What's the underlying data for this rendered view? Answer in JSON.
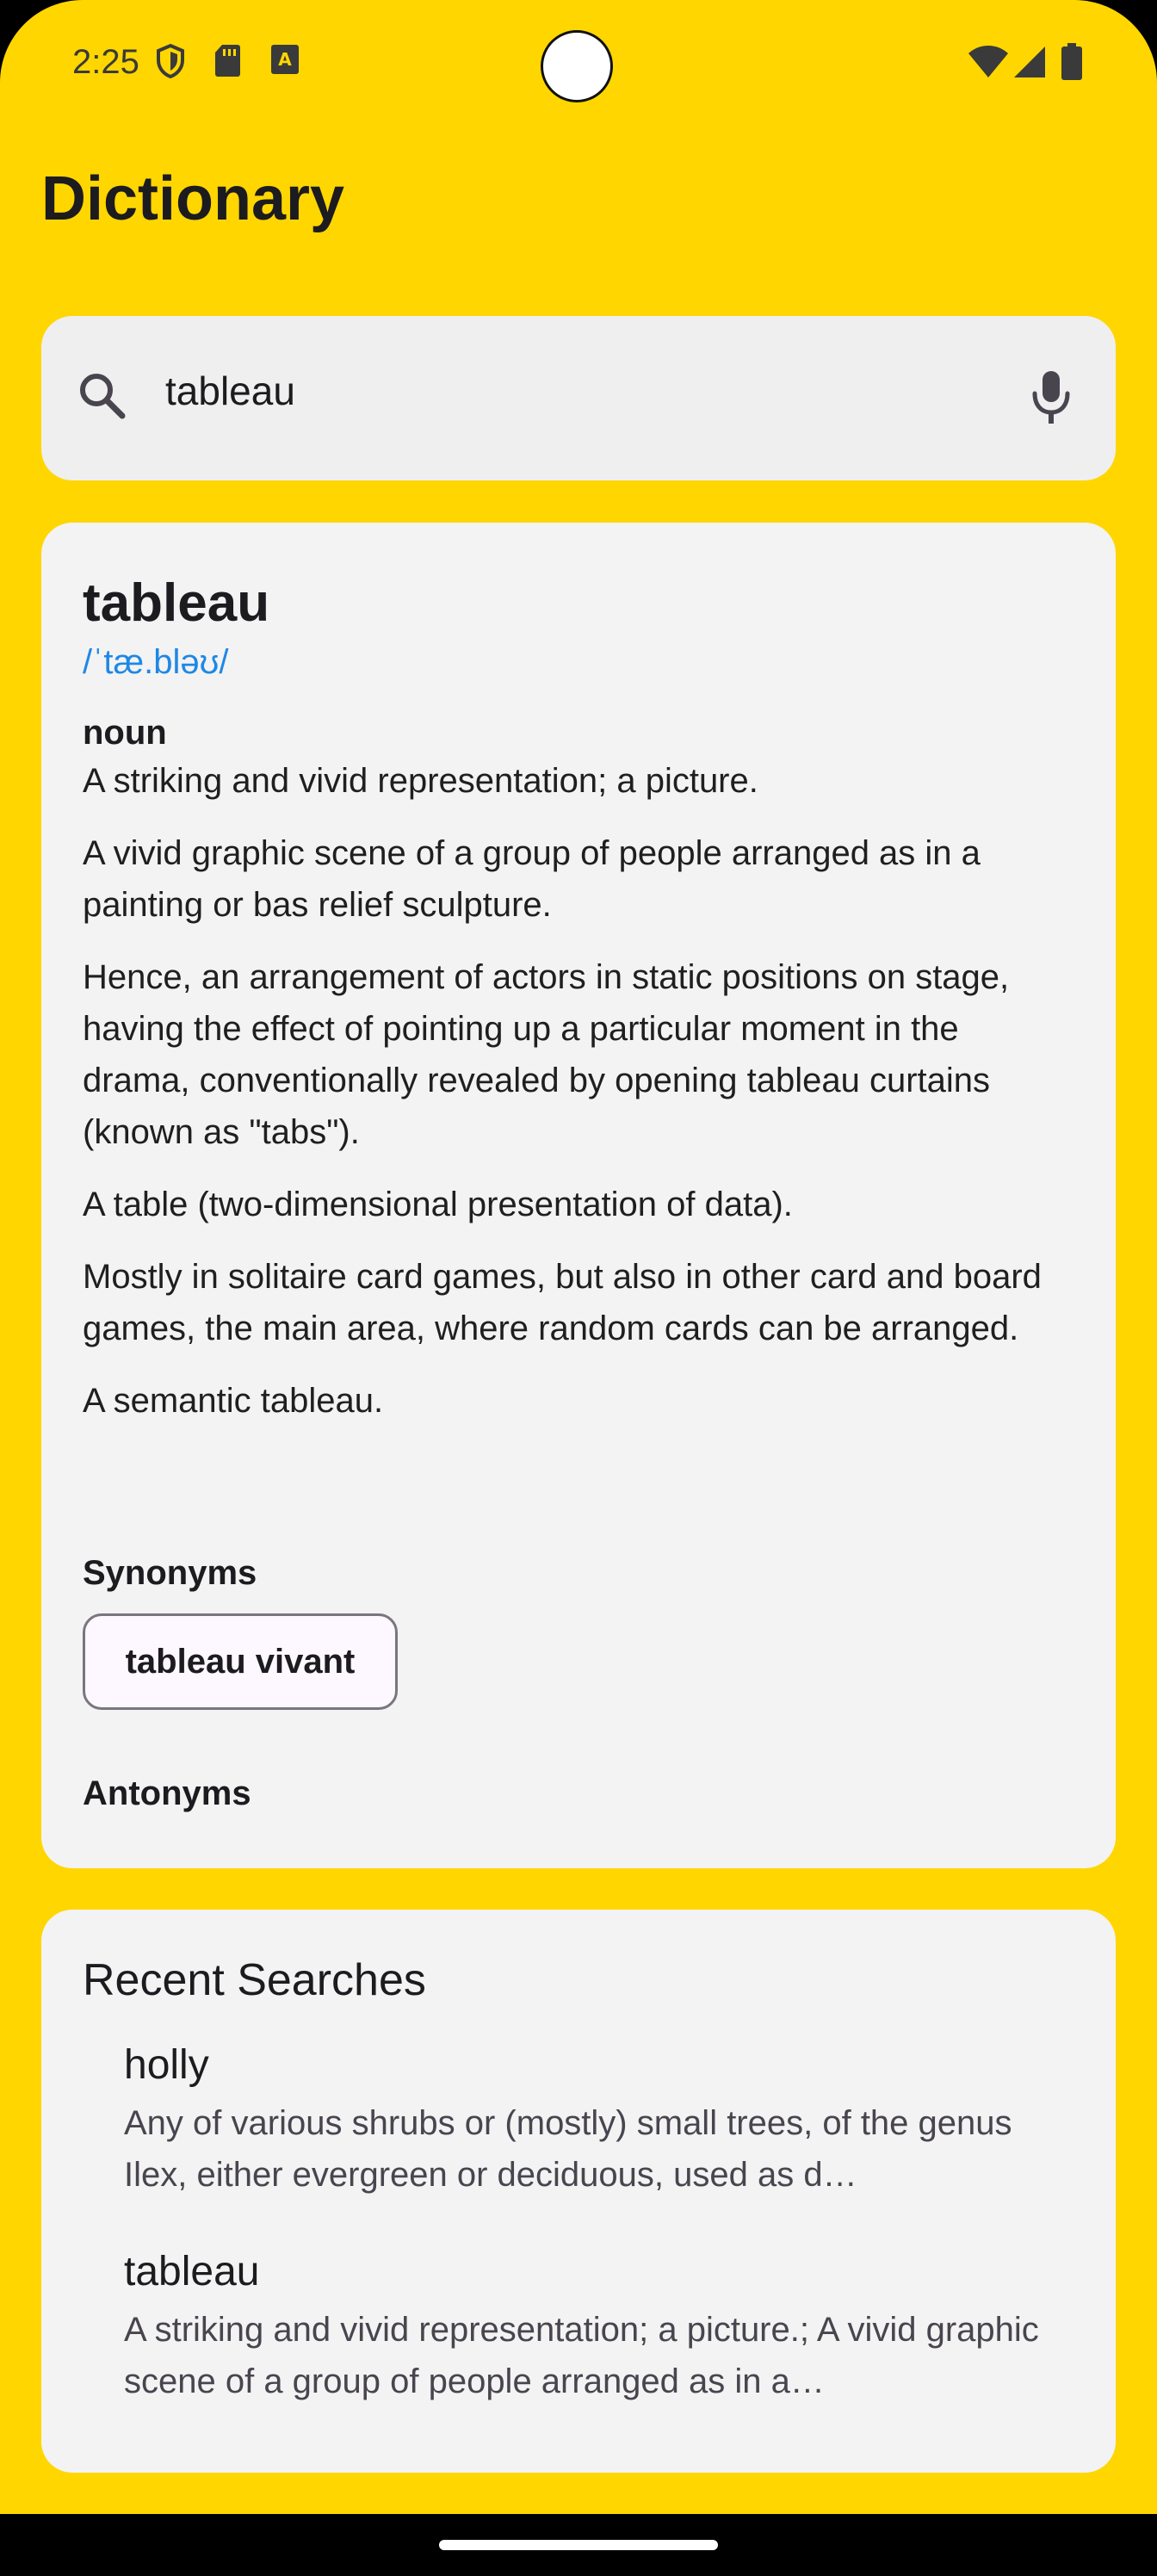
{
  "status_bar": {
    "time": "2:25",
    "left_icons": [
      "shield-icon",
      "sd-card-icon",
      "font-notification-icon"
    ],
    "right_icons": [
      "wifi-icon",
      "cellular-signal-icon",
      "battery-icon"
    ]
  },
  "app": {
    "title": "Dictionary",
    "accent_color": "#FFD600"
  },
  "search": {
    "value": "tableau",
    "leading_icon": "search-icon",
    "trailing_icon": "mic-icon"
  },
  "entry": {
    "word": "tableau",
    "phonetic": "/ˈtæ.bləʊ/",
    "part_of_speech": "noun",
    "definitions": [
      "A striking and vivid representation; a picture.",
      "A vivid graphic scene of a group of people arranged as in a painting or bas relief sculpture.",
      "Hence, an arrangement of actors in static positions on stage, having the effect of pointing up a particular moment in the drama, conventionally revealed by opening tableau curtains (known as \"tabs\").",
      "A table (two-dimensional presentation of data).",
      "Mostly in solitaire card games, but also in other card and board games, the main area, where random cards can be arranged.",
      "A semantic tableau."
    ],
    "synonyms_label": "Synonyms",
    "synonyms": [
      "tableau vivant"
    ],
    "antonyms_label": "Antonyms"
  },
  "recent": {
    "title": "Recent Searches",
    "items": [
      {
        "word": "holly",
        "snippet": "Any of various shrubs or (mostly) small trees, of the genus Ilex, either evergreen or deciduous, used as d…"
      },
      {
        "word": "tableau",
        "snippet": "A striking and vivid representation; a picture.; A vivid graphic scene of a group of people arranged as in a…"
      }
    ]
  }
}
